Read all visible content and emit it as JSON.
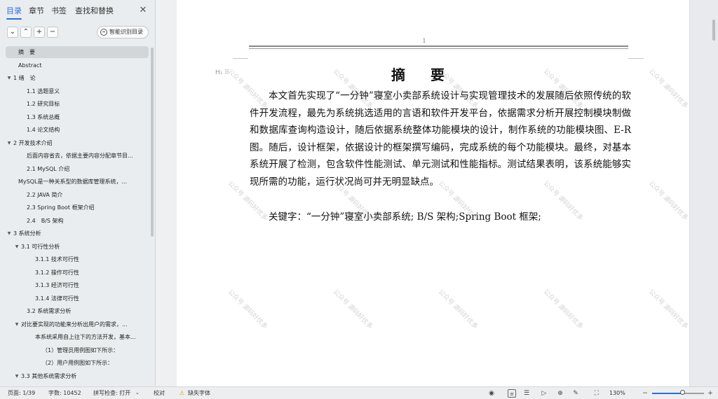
{
  "nav": {
    "tabs": [
      {
        "label": "目录",
        "active": true
      },
      {
        "label": "章节",
        "active": false
      },
      {
        "label": "书签",
        "active": false
      },
      {
        "label": "查找和替换",
        "active": false
      }
    ],
    "close_icon": "close-icon",
    "tools": {
      "collapse_icon": "chevron-down-icon",
      "expand_icon": "chevron-up-icon",
      "add_icon": "plus-icon",
      "remove_icon": "minus-icon",
      "smart_toc_label": "智能识别目录"
    },
    "toc": [
      {
        "text": "摘　要",
        "level": 0,
        "arrow": false,
        "selected": true
      },
      {
        "text": "Abstract",
        "level": 0,
        "arrow": false
      },
      {
        "text": "1 绪　论",
        "level": 0,
        "arrow": true
      },
      {
        "text": "1.1 选题意义",
        "level": 1,
        "arrow": false
      },
      {
        "text": "1.2 研究目标",
        "level": 1,
        "arrow": false
      },
      {
        "text": "1.3 系统总概",
        "level": 1,
        "arrow": false
      },
      {
        "text": "1.4 论文结构",
        "level": 1,
        "arrow": false
      },
      {
        "text": "2 开发技术介绍",
        "level": 0,
        "arrow": true
      },
      {
        "text": "后面内容省去，依据主要内容分配章节目...",
        "level": 1,
        "arrow": false
      },
      {
        "text": "2.1 MySQL 介绍",
        "level": 1,
        "arrow": false
      },
      {
        "text": "MySQL是一种关系型的数据库管理系统，...",
        "level": 0,
        "arrow": false
      },
      {
        "text": "2.2 JAVA 简介",
        "level": 1,
        "arrow": false
      },
      {
        "text": "2.3 Spring Boot 框架介绍",
        "level": 1,
        "arrow": false
      },
      {
        "text": "2.4　B/S 架构",
        "level": 1,
        "arrow": false
      },
      {
        "text": "3 系统分析",
        "level": 0,
        "arrow": true
      },
      {
        "text": "3.1 可行性分析",
        "level": 1,
        "arrow": true
      },
      {
        "text": "3.1.1 技术可行性",
        "level": 2,
        "arrow": false
      },
      {
        "text": "3.1.2 操作可行性",
        "level": 2,
        "arrow": false
      },
      {
        "text": "3.1.3 经济可行性",
        "level": 2,
        "arrow": false
      },
      {
        "text": "3.1.4 法律可行性",
        "level": 2,
        "arrow": false
      },
      {
        "text": "3.2 系统需求分析",
        "level": 1,
        "arrow": false
      },
      {
        "text": "对比要实现的功能来分析出用户的需求，...",
        "level": 1,
        "arrow": true
      },
      {
        "text": "本系统采用自上往下的方法开发，基本...",
        "level": 2,
        "arrow": false
      },
      {
        "text": "（1）管理员用例图如下所示：",
        "level": 3,
        "arrow": false
      },
      {
        "text": "（2）用户用例图如下所示：",
        "level": 3,
        "arrow": false
      },
      {
        "text": "3.3 其他系统需求分析",
        "level": 1,
        "arrow": true
      }
    ]
  },
  "document": {
    "page_number": "1",
    "heading_marker": "H₁ ⠿",
    "title": "摘　要",
    "body": "本文首先实现了“一分钟”寝室小卖部系统设计与实现管理技术的发展随后依照传统的软件开发流程，最先为系统挑选适用的言语和软件开发平台，依据需求分析开展控制模块制做和数据库查询构造设计，随后依据系统整体功能模块的设计，制作系统的功能模块图、E-R 图。随后，设计框架，依据设计的框架撰写编码，完成系统的每个功能模块。最终，对基本系统开展了检测，包含软件性能测试、单元测试和性能指标。测试结果表明，该系统能够实现所需的功能，运行状况尚可并无明显缺点。",
    "keywords": "关键字：“一分钟”寝室小卖部系统; B/S 架构;Spring Boot 框架;",
    "watermark": "公众号 源码好优多"
  },
  "status_bar": {
    "page": "页面: 1/39",
    "word_count": "字数: 10452",
    "spell_check": "拼写检查: 打开",
    "spell_check_chevron": "chevron-down-icon",
    "proofread": "校对",
    "missing_font_icon": "warning-icon",
    "missing_font": "缺失字体",
    "view_icons": [
      "eye-icon",
      "page-view-icon",
      "outline-view-icon",
      "play-icon",
      "web-view-icon",
      "pen-icon",
      "fit-page-icon"
    ],
    "zoom_level": "130%",
    "zoom_fraction": 0.6,
    "zoom_out_icon": "minus-icon",
    "zoom_in_icon": "plus-icon"
  },
  "colors": {
    "accent": "#2a6fdb",
    "warning": "#e0a100"
  }
}
